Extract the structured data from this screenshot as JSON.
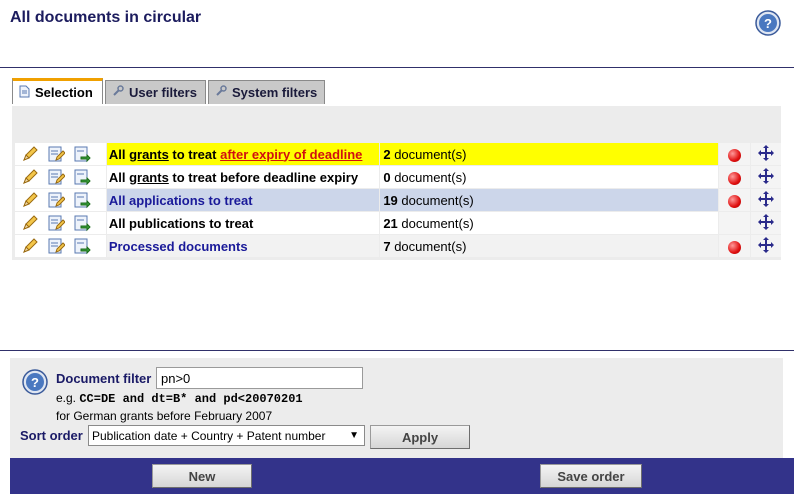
{
  "page": {
    "title": "All documents in circular"
  },
  "tabs": [
    {
      "label": "Selection",
      "icon": "document-icon",
      "active": true
    },
    {
      "label": "User filters",
      "icon": "wrench-icon",
      "active": false
    },
    {
      "label": "System filters",
      "icon": "wrench-icon",
      "active": false
    }
  ],
  "rows": [
    {
      "name_parts": [
        "All ",
        "grants",
        " to treat ",
        "after expiry of deadline"
      ],
      "count": "2",
      "count_unit": "document(s)",
      "has_dot": true,
      "style": "yellow"
    },
    {
      "name_parts": [
        "All ",
        "grants",
        " to treat before deadline expiry"
      ],
      "count": "0",
      "count_unit": "document(s)",
      "has_dot": true,
      "style": "white"
    },
    {
      "name": "All applications to treat",
      "count": "19",
      "count_unit": "document(s)",
      "has_dot": true,
      "style": "blue"
    },
    {
      "name": "All publications to treat",
      "count": "21",
      "count_unit": "document(s)",
      "has_dot": false,
      "style": "white"
    },
    {
      "name": "Processed documents",
      "count": "7",
      "count_unit": "document(s)",
      "has_dot": true,
      "style": "grey"
    }
  ],
  "filter": {
    "label": "Document filter",
    "value": "pn>0",
    "example_prefix": "e.g. ",
    "example_code": "CC=DE and dt=B* and pd<20070201",
    "hint": "for German grants before February 2007"
  },
  "sort": {
    "label": "Sort order",
    "selected": "Publication date + Country + Patent number"
  },
  "buttons": {
    "apply": "Apply",
    "new": "New",
    "save_order": "Save order"
  },
  "colors": {
    "title": "#1c1c5e",
    "highlight_row": "#ffff00",
    "selected_row": "#ccd6ea",
    "bottom_bar": "#33338a",
    "tab_accent": "#f0a000",
    "status_dot": "#e01010"
  }
}
